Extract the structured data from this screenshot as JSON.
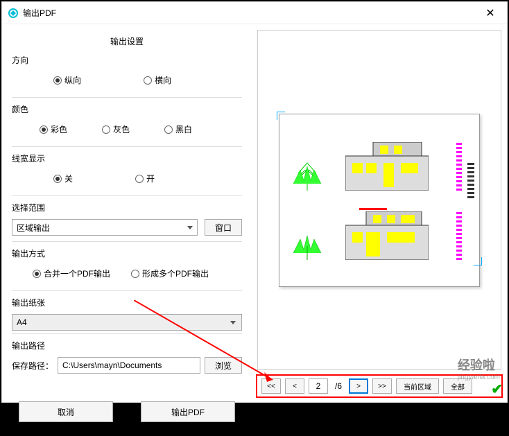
{
  "titlebar": {
    "title": "输出PDF",
    "close": "✕"
  },
  "settings": {
    "heading": "输出设置",
    "direction": {
      "label": "方向",
      "portrait": "纵向",
      "landscape": "横向"
    },
    "color": {
      "label": "颜色",
      "color_opt": "彩色",
      "gray_opt": "灰色",
      "bw_opt": "黑白"
    },
    "lineweight": {
      "label": "线宽显示",
      "off": "关",
      "on": "开"
    },
    "range": {
      "label": "选择范围",
      "value": "区域输出",
      "window_btn": "窗口"
    },
    "output_mode": {
      "label": "输出方式",
      "merge": "合并一个PDF输出",
      "multi": "形成多个PDF输出"
    },
    "paper": {
      "label": "输出纸张",
      "value": "A4"
    },
    "path": {
      "label": "输出路径",
      "save_label": "保存路径：",
      "value": "C:\\Users\\mayn\\Documents",
      "browse": "浏览"
    },
    "cancel": "取消",
    "export": "输出PDF"
  },
  "pager": {
    "first": "<<",
    "prev": "<",
    "current": "2",
    "total": "/6",
    "next": ">",
    "last": ">>",
    "current_area": "当前区域",
    "all": "全部"
  },
  "watermark": {
    "main": "经验啦",
    "sub": "jingyanla.com"
  }
}
